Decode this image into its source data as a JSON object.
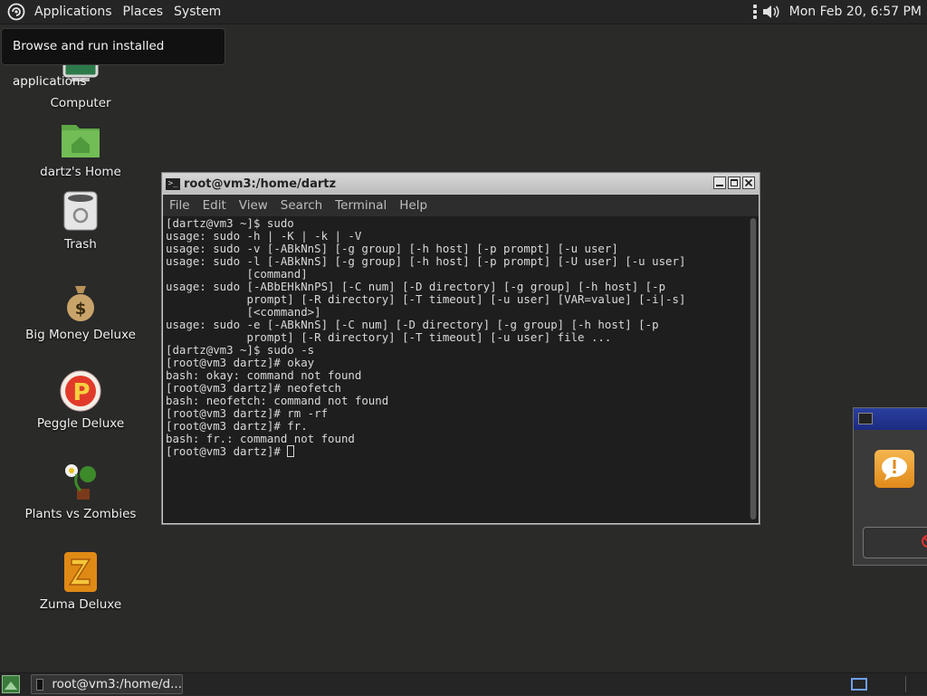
{
  "top_panel": {
    "menus": [
      "Applications",
      "Places",
      "System"
    ],
    "clock": "Mon Feb 20,  6:57 PM"
  },
  "tooltip": "Browse and run installed applications",
  "desktop_icons": [
    {
      "label": "Computer",
      "icon": "computer-icon"
    },
    {
      "label": "dartz's Home",
      "icon": "home-folder-icon"
    },
    {
      "label": "Trash",
      "icon": "trash-icon"
    },
    {
      "label": "Big Money Deluxe",
      "icon": "money-bag-icon"
    },
    {
      "label": "Peggle Deluxe",
      "icon": "peggle-icon"
    },
    {
      "label": "Plants vs Zombies",
      "icon": "plant-icon"
    },
    {
      "label": "Zuma Deluxe",
      "icon": "zuma-icon"
    }
  ],
  "terminal": {
    "title": "root@vm3:/home/dartz",
    "menu": [
      "File",
      "Edit",
      "View",
      "Search",
      "Terminal",
      "Help"
    ],
    "output": "[dartz@vm3 ~]$ sudo\nusage: sudo -h | -K | -k | -V\nusage: sudo -v [-ABkNnS] [-g group] [-h host] [-p prompt] [-u user]\nusage: sudo -l [-ABkNnS] [-g group] [-h host] [-p prompt] [-U user] [-u user]\n            [command]\nusage: sudo [-ABbEHkNnPS] [-C num] [-D directory] [-g group] [-h host] [-p\n            prompt] [-R directory] [-T timeout] [-u user] [VAR=value] [-i|-s]\n            [<command>]\nusage: sudo -e [-ABkNnS] [-C num] [-D directory] [-g group] [-h host] [-p\n            prompt] [-R directory] [-T timeout] [-u user] file ...\n[dartz@vm3 ~]$ sudo -s\n[root@vm3 dartz]# okay\nbash: okay: command not found\n[root@vm3 dartz]# neofetch\nbash: neofetch: command not found\n[root@vm3 dartz]# rm -rf\n[root@vm3 dartz]# fr.\nbash: fr.: command not found\n[root@vm3 dartz]# "
  },
  "taskbar": {
    "window_label": "root@vm3:/home/d..."
  },
  "colors": {
    "desktop_bg": "#2a2a29",
    "panel_bg": "#252525",
    "terminal_bg": "#1e1e1e",
    "dialog_title": "#1c2b80"
  }
}
